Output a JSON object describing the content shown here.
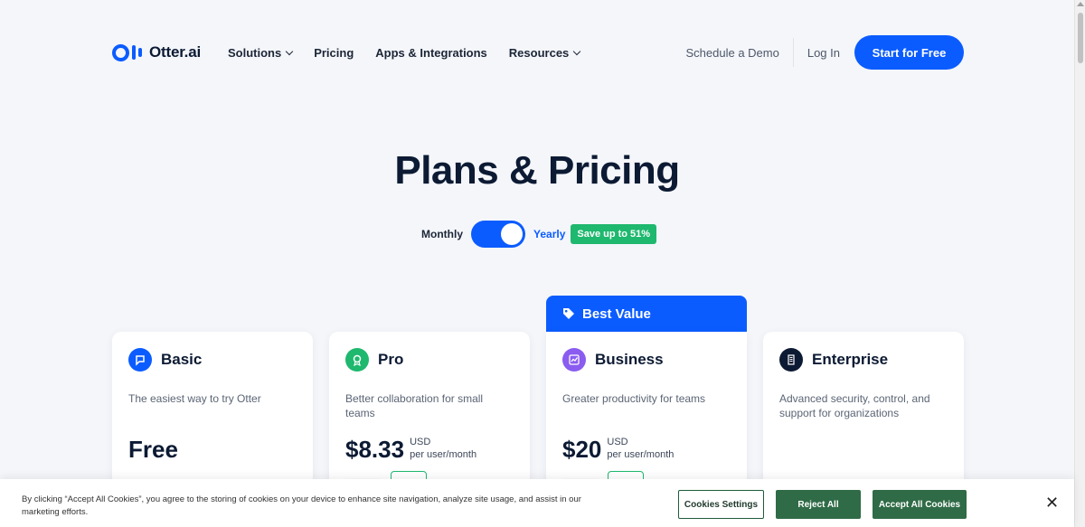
{
  "header": {
    "logo_text": "Otter.ai",
    "nav": [
      {
        "label": "Solutions",
        "has_dropdown": true
      },
      {
        "label": "Pricing",
        "has_dropdown": false
      },
      {
        "label": "Apps & Integrations",
        "has_dropdown": false
      },
      {
        "label": "Resources",
        "has_dropdown": true
      }
    ],
    "schedule_demo": "Schedule a Demo",
    "log_in": "Log In",
    "start_free": "Start for Free"
  },
  "main": {
    "title": "Plans & Pricing",
    "billing_toggle": {
      "monthly_label": "Monthly",
      "yearly_label": "Yearly",
      "selected": "Yearly",
      "save_badge": "Save up to 51%"
    },
    "best_value_label": "Best Value",
    "plans": [
      {
        "name": "Basic",
        "icon": "chat-bubble-icon",
        "icon_color": "#0b5cff",
        "description": "The easiest way to try Otter",
        "price": "Free",
        "currency": "",
        "period": ""
      },
      {
        "name": "Pro",
        "icon": "badge-icon",
        "icon_color": "#1eb86e",
        "description": "Better collaboration for small teams",
        "price": "$8.33",
        "currency": "USD",
        "period": "per user/month"
      },
      {
        "name": "Business",
        "icon": "chart-icon",
        "icon_color": "#8a5cf0",
        "description": "Greater productivity for teams",
        "price": "$20",
        "currency": "USD",
        "period": "per user/month"
      },
      {
        "name": "Enterprise",
        "icon": "building-icon",
        "icon_color": "#0c1a33",
        "description": "Advanced security, control, and support for organizations",
        "price": "",
        "currency": "",
        "period": ""
      }
    ]
  },
  "cookie_banner": {
    "text": "By clicking “Accept All Cookies”, you agree to the storing of cookies on your device to enhance site navigation, analyze site usage, and assist in our marketing efforts.",
    "settings_label": "Cookies Settings",
    "reject_label": "Reject All",
    "accept_label": "Accept All Cookies",
    "close_symbol": "✕"
  },
  "colors": {
    "brand_blue": "#0b5cff",
    "save_green": "#1eb86e",
    "cookie_green": "#2f6b46"
  }
}
